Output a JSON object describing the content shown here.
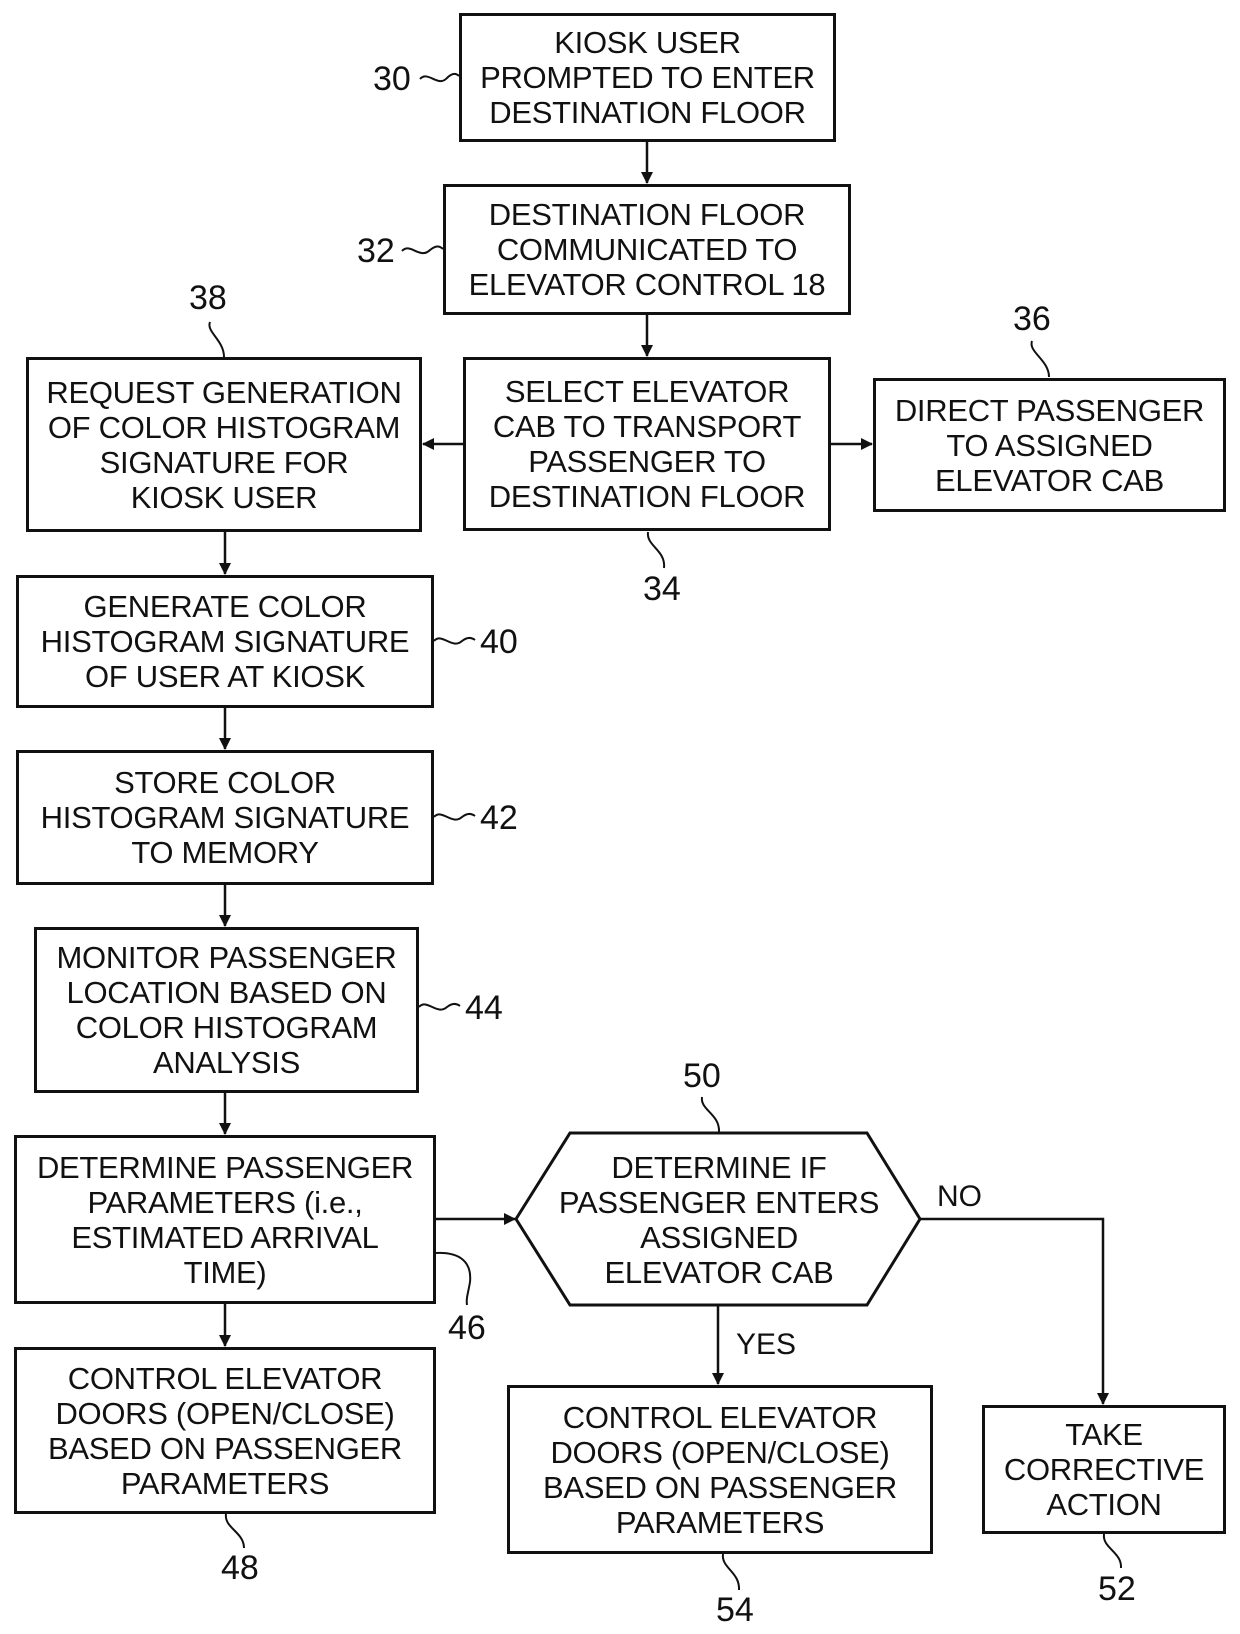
{
  "figure": {
    "nodes": {
      "n30": {
        "ref": "30",
        "lines": [
          "KIOSK USER",
          "PROMPTED TO ENTER",
          "DESTINATION FLOOR"
        ]
      },
      "n32": {
        "ref": "32",
        "lines": [
          "DESTINATION FLOOR",
          "COMMUNICATED TO",
          "ELEVATOR CONTROL 18"
        ]
      },
      "n34": {
        "ref": "34",
        "lines": [
          "SELECT ELEVATOR",
          "CAB TO TRANSPORT",
          "PASSENGER TO",
          "DESTINATION FLOOR"
        ]
      },
      "n36": {
        "ref": "36",
        "lines": [
          "DIRECT PASSENGER",
          "TO ASSIGNED",
          "ELEVATOR CAB"
        ]
      },
      "n38": {
        "ref": "38",
        "lines": [
          "REQUEST GENERATION",
          "OF COLOR HISTOGRAM",
          "SIGNATURE FOR",
          "KIOSK USER"
        ]
      },
      "n40": {
        "ref": "40",
        "lines": [
          "GENERATE COLOR",
          "HISTOGRAM SIGNATURE",
          "OF USER AT KIOSK"
        ]
      },
      "n42": {
        "ref": "42",
        "lines": [
          "STORE COLOR",
          "HISTOGRAM SIGNATURE",
          "TO MEMORY"
        ]
      },
      "n44": {
        "ref": "44",
        "lines": [
          "MONITOR PASSENGER",
          "LOCATION BASED ON",
          "COLOR HISTOGRAM",
          "ANALYSIS"
        ]
      },
      "n46": {
        "ref": "46",
        "lines": [
          "DETERMINE PASSENGER",
          "PARAMETERS (i.e.,",
          "ESTIMATED ARRIVAL",
          "TIME)"
        ]
      },
      "n48": {
        "ref": "48",
        "lines": [
          "CONTROL ELEVATOR",
          "DOORS (OPEN/CLOSE)",
          "BASED ON PASSENGER",
          "PARAMETERS"
        ]
      },
      "n50": {
        "ref": "50",
        "lines": [
          "DETERMINE IF",
          "PASSENGER ENTERS",
          "ASSIGNED",
          "ELEVATOR CAB"
        ]
      },
      "n52": {
        "ref": "52",
        "lines": [
          "TAKE",
          "CORRECTIVE",
          "ACTION"
        ]
      },
      "n54": {
        "ref": "54",
        "lines": [
          "CONTROL ELEVATOR",
          "DOORS (OPEN/CLOSE)",
          "BASED ON PASSENGER",
          "PARAMETERS"
        ]
      }
    },
    "edges": [
      {
        "from": "30",
        "to": "32",
        "label": ""
      },
      {
        "from": "32",
        "to": "34",
        "label": ""
      },
      {
        "from": "34",
        "to": "38",
        "label": ""
      },
      {
        "from": "34",
        "to": "36",
        "label": ""
      },
      {
        "from": "38",
        "to": "40",
        "label": ""
      },
      {
        "from": "40",
        "to": "42",
        "label": ""
      },
      {
        "from": "42",
        "to": "44",
        "label": ""
      },
      {
        "from": "44",
        "to": "46",
        "label": ""
      },
      {
        "from": "46",
        "to": "48",
        "label": ""
      },
      {
        "from": "46",
        "to": "50",
        "label": ""
      },
      {
        "from": "50",
        "to": "54",
        "label": "YES"
      },
      {
        "from": "50",
        "to": "52",
        "label": "NO"
      }
    ],
    "edge_labels": {
      "yes": "YES",
      "no": "NO"
    },
    "colors": {
      "ink": "#111111",
      "background": "#ffffff"
    }
  }
}
